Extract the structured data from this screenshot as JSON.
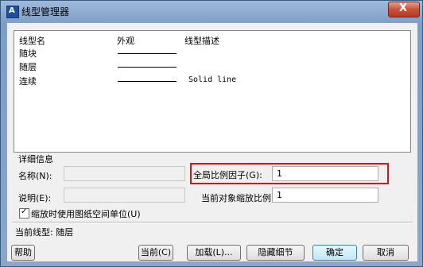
{
  "window": {
    "title": "线型管理器",
    "close_glyph": "X"
  },
  "list": {
    "headers": [
      "线型名",
      "外观",
      "线型描述"
    ],
    "rows": [
      {
        "name": "随块",
        "description": ""
      },
      {
        "name": "随层",
        "description": ""
      },
      {
        "name": "连续",
        "description": "Solid line"
      }
    ]
  },
  "details": {
    "section_label": "详细信息",
    "name_label": "名称(N):",
    "name_value": "",
    "desc_label": "说明(E):",
    "desc_value": "",
    "global_scale_label": "全局比例因子(G):",
    "global_scale_value": "1",
    "current_scale_label": "当前对象缩放比例(O):",
    "current_scale_value": "1",
    "paperspace_label": "缩放时使用图纸空间单位(U)",
    "paperspace_checked": "✓"
  },
  "status": {
    "current_linetype": "当前线型: 随层"
  },
  "buttons": {
    "help": "帮助",
    "current": "当前(C)",
    "load": "加载(L)...",
    "hide_details": "隐藏细节",
    "ok": "确定",
    "cancel": "取消"
  }
}
